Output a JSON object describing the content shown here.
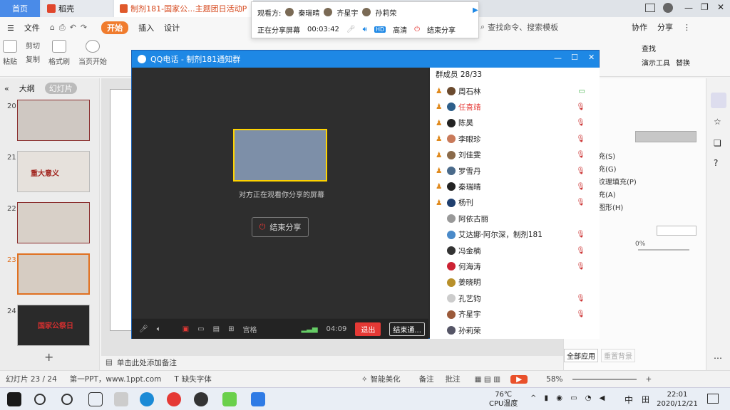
{
  "tabs": [
    {
      "label": "首页"
    },
    {
      "label": "稻壳"
    },
    {
      "label": "制剂181-国家公...主题团日活动PPT"
    }
  ],
  "share_panel": {
    "viewers_label": "观看方:",
    "viewers": [
      "秦瑞晴",
      "齐星宇",
      "孙莉荣"
    ],
    "status": "正在分享屏幕",
    "timer": "00:03:42",
    "quality_badge": "HD",
    "quality": "高清",
    "end_label": "结束分享"
  },
  "ribbon": {
    "menu": [
      "文件",
      "开始",
      "插入",
      "设计"
    ],
    "search_placeholder": "查找命令、搜索模板",
    "collab": "协作",
    "share": "分享",
    "tools": [
      "粘贴",
      "剪切",
      "复制",
      "格式刷",
      "当页开始"
    ],
    "right_tools": [
      "演示工具",
      "查找",
      "替换"
    ],
    "font_size": "0"
  },
  "left_pane": {
    "tabs": [
      "大纲",
      "幻灯片"
    ],
    "slides": [
      {
        "num": "20",
        "title": ""
      },
      {
        "num": "21",
        "title": "重大意义"
      },
      {
        "num": "22",
        "title": ""
      },
      {
        "num": "23",
        "title": ""
      },
      {
        "num": "24",
        "title": "国家公祭日"
      }
    ],
    "add": "+"
  },
  "qq": {
    "title": "QQ电话 - 制剂181通知群",
    "watching_text": "对方正在观看你分享的屏幕",
    "end_share": "结束分享",
    "bottom": {
      "grid": "宫格",
      "signal": "04:09",
      "exit": "退出",
      "end_call": "结束通..."
    },
    "members_header": "群成员 28/33",
    "members": [
      "周石林",
      "任喜靖",
      "陈昊",
      "李眼珍",
      "刘佳雯",
      "罗雪丹",
      "秦瑞晴",
      "杨刊",
      "阿依古丽",
      "艾达娜·阿尔深，制剂181",
      "冯金楠",
      "何海涛",
      "姜晓明",
      "孔艺钧",
      "齐星宇",
      "孙莉荣"
    ]
  },
  "editor": {
    "notes_placeholder": "单击此处添加备注"
  },
  "right_panel": {
    "options": [
      "充(S)",
      "充(G)",
      "纹理填充(P)",
      "充(A)",
      "图形(H)"
    ],
    "percent": "0%",
    "apply_all": "全部应用",
    "reset": "重置背景"
  },
  "statusbar": {
    "slide_count": "幻灯片 23 / 24",
    "template": "第一PPT，www.1ppt.com",
    "missing_font": "缺失字体",
    "beautify": "智能美化",
    "notes": "备注",
    "comments": "批注",
    "zoom": "58%"
  },
  "taskbar": {
    "temp": "76℃",
    "cpu": "CPU温度",
    "lang": "中",
    "time": "22:01",
    "date": "2020/12/21"
  }
}
